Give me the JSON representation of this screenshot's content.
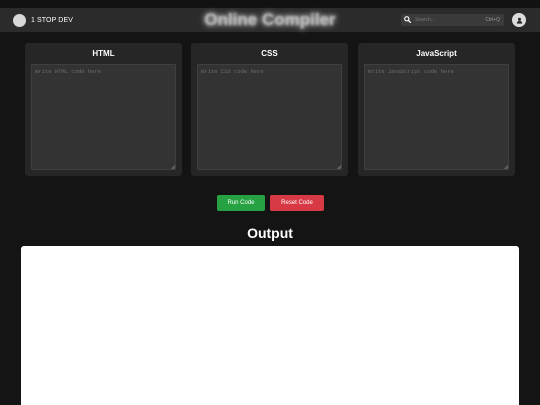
{
  "navbar": {
    "brand": "1 STOP DEV",
    "title": "Online Compiler",
    "search": {
      "placeholder": "Search...",
      "shortcut": "Ctrl+Q"
    }
  },
  "editors": [
    {
      "title": "HTML",
      "placeholder": "Write HTML code here"
    },
    {
      "title": "CSS",
      "placeholder": "Write CSS code here"
    },
    {
      "title": "JavaScript",
      "placeholder": "Write JavaScript code here"
    }
  ],
  "actions": {
    "run_label": "Run Code",
    "reset_label": "Reset Code"
  },
  "output": {
    "title": "Output"
  },
  "colors": {
    "background": "#141414",
    "navbar": "#2b2b2b",
    "panel": "#262626",
    "editor": "#333333",
    "run": "#27a243",
    "reset": "#d83a45"
  },
  "icons": {
    "brand_logo": "circle-logo-icon",
    "search": "magnifier-icon",
    "avatar": "user-icon"
  }
}
